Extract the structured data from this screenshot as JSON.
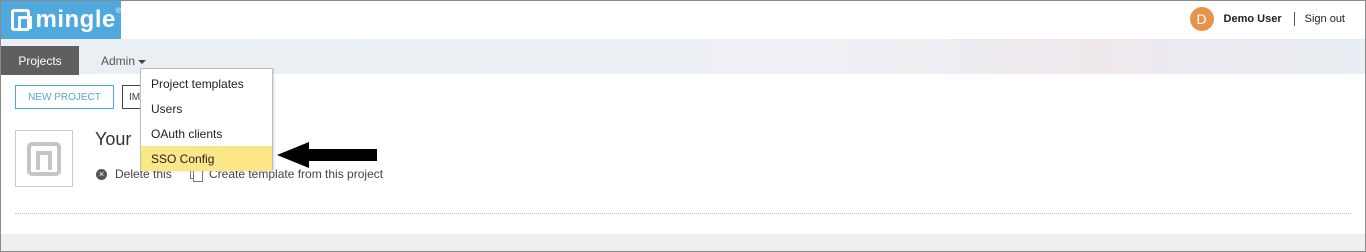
{
  "header": {
    "logo_text": "mingle",
    "logo_reg": "®",
    "user_initial": "D",
    "user_name": "Demo User",
    "signout_label": "Sign out",
    "accent_color": "#4fa8de",
    "avatar_color": "#e8924a"
  },
  "nav": {
    "projects_label": "Projects",
    "admin_label": "Admin"
  },
  "admin_menu": {
    "items": [
      {
        "label": "Project templates"
      },
      {
        "label": "Users"
      },
      {
        "label": "OAuth clients"
      },
      {
        "label": "SSO Config",
        "highlighted": true
      }
    ],
    "highlight_color": "#fbe788"
  },
  "toolbar": {
    "new_project_label": "NEW PROJECT",
    "import_label": "IM"
  },
  "project": {
    "title": "Your",
    "delete_label": "Delete this",
    "template_label": "Create template from this project",
    "icons": [
      "project-logo-icon",
      "close-circle-icon",
      "copy-icon"
    ]
  },
  "annotation": {
    "icon": "arrow-left-icon"
  }
}
